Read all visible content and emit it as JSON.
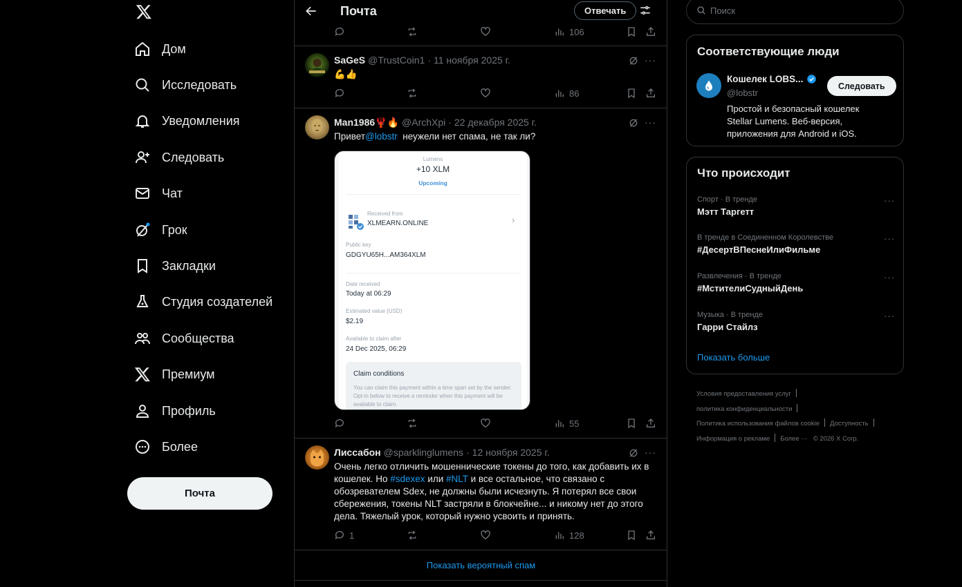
{
  "nav": {
    "items": [
      {
        "label": "Дом",
        "icon": "home-icon"
      },
      {
        "label": "Исследовать",
        "icon": "search-icon"
      },
      {
        "label": "Уведомления",
        "icon": "bell-icon"
      },
      {
        "label": "Следовать",
        "icon": "add-user-icon"
      },
      {
        "label": "Чат",
        "icon": "mail-icon"
      },
      {
        "label": "Грок",
        "icon": "grok-icon"
      },
      {
        "label": "Закладки",
        "icon": "bookmark-icon"
      },
      {
        "label": "Студия создателей",
        "icon": "flask-icon"
      },
      {
        "label": "Сообщества",
        "icon": "communities-icon"
      },
      {
        "label": "Премиум",
        "icon": "x-logo-icon"
      },
      {
        "label": "Профиль",
        "icon": "person-icon"
      },
      {
        "label": "Более",
        "icon": "more-circle-icon"
      }
    ],
    "post_button": "Почта"
  },
  "header": {
    "title": "Почта",
    "reply_button": "Отвечать"
  },
  "top_actions": {
    "views": "106"
  },
  "tweets": [
    {
      "name": "SaGeS",
      "handle": "@TrustCoin1",
      "date": "11 ноября 2025 г.",
      "text": "💪👍",
      "replies": "",
      "views": "86"
    },
    {
      "name": "Man1986🦞🔥",
      "handle": "@ArchXpi",
      "date": "22 декабря 2025 г.",
      "text_before": "Привет",
      "mention": "@lobstr",
      "text_after": "  неужели нет спама, не так ли?",
      "replies": "",
      "views": "55",
      "media": {
        "asset": "Lumens",
        "amount": "+10 XLM",
        "status": "Upcoming",
        "received_from_label": "Received from",
        "received_from": "XLMEARN.ONLINE",
        "public_key_label": "Public key",
        "public_key": "GDGYU65H...AM364XLM",
        "date_label": "Date received",
        "date": "Today at 06:29",
        "est_label": "Estimated value (USD)",
        "est": "$2.19",
        "claim_after_label": "Available to claim after",
        "claim_after": "24 Dec 2025, 06:29",
        "conditions_title": "Claim conditions",
        "conditions_text": "You can claim this payment within a time span set by the sender. Opt-in below to receive a reminder when this payment will be available to claim."
      }
    },
    {
      "name": "Лиссабон",
      "handle": "@sparklinglumens",
      "date": "12 ноября 2025 г.",
      "text_1": "Очень легко отличить мошеннические токены до того, как добавить их в кошелек. Но ",
      "tag_1": "#sdexex",
      "text_2": " или ",
      "tag_2": "#NLT",
      "text_3": " и все остальное, что связано с обозревателем Sdex, не должны были исчезнуть. Я потерял все свои сбережения, токены NLT застряли в блокчейне... и никому нет до этого дела. Тяжелый урок, который нужно усвоить и принять.",
      "replies": "1",
      "views": "128"
    }
  ],
  "show_spam": "Показать вероятный спам",
  "search": {
    "placeholder": "Поиск"
  },
  "relevant": {
    "title": "Соответствующие люди",
    "name": "Кошелек LOBS...",
    "handle": "@lobstr",
    "bio": "Простой и безопасный кошелек Stellar Lumens. Веб-версия, приложения для Android и iOS.",
    "follow": "Следовать"
  },
  "trends": {
    "title": "Что происходит",
    "items": [
      {
        "meta": "Спорт · В тренде",
        "name": "Мэтт Таргетт"
      },
      {
        "meta": "В тренде в Соединенном Королевстве",
        "name": "#ДесертВПеснеИлиФильме"
      },
      {
        "meta": "Развлечения · В тренде",
        "name": "#МстителиСудныйДень"
      },
      {
        "meta": "Музыка · В тренде",
        "name": "Гарри Стайлз"
      }
    ],
    "show_more": "Показать больше"
  },
  "footer": {
    "terms": "Условия предоставления услуг",
    "privacy": "политика конфиденциальности",
    "cookies": "Политика использования файлов cookie",
    "accessibility": "Доступность",
    "ads": "Информация о рекламе",
    "more": "Более ···",
    "copyright": "© 2026 X Corp."
  },
  "colors": {
    "accent": "#1d9bf0",
    "background": "#000000",
    "border": "#2f3336",
    "muted": "#71767b"
  }
}
